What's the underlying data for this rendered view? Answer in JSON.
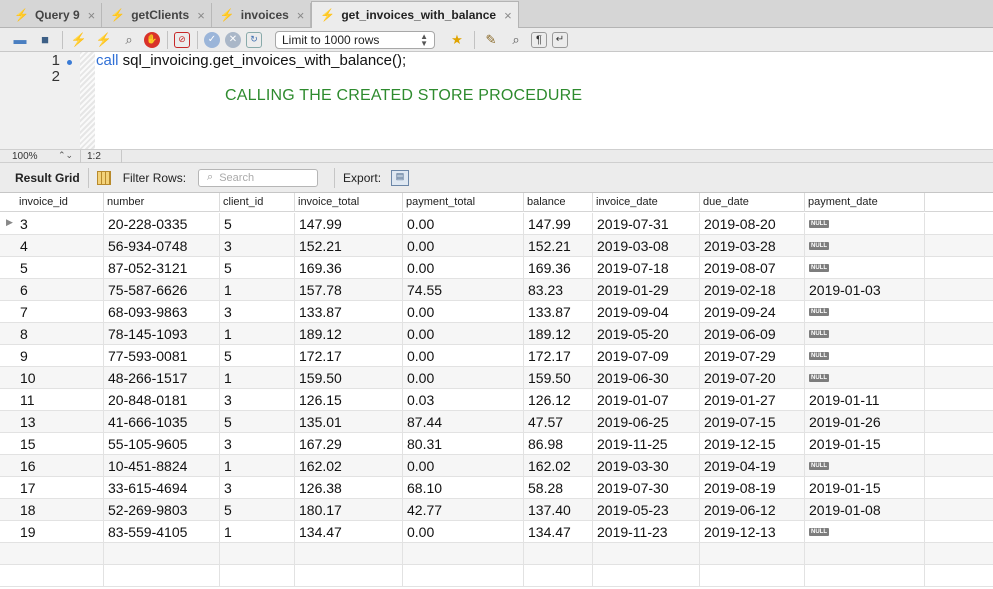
{
  "tabs": [
    {
      "label": "Query 9",
      "active": false
    },
    {
      "label": "getClients",
      "active": false
    },
    {
      "label": "invoices",
      "active": false
    },
    {
      "label": "get_invoices_with_balance",
      "active": true
    }
  ],
  "toolbar": {
    "limit_value": "Limit to 1000 rows",
    "icons": [
      "open-file-icon",
      "save-icon",
      "execute-icon",
      "execute-current-icon",
      "explain-icon",
      "stop-icon",
      "toggle-error-icon",
      "commit-icon",
      "rollback-icon",
      "autocommit-icon",
      "bookmark-icon",
      "beautify-icon",
      "find-icon",
      "invisible-chars-icon",
      "wrap-icon"
    ]
  },
  "editor": {
    "lines": [
      {
        "number": "1",
        "keyword": "call",
        "rest": " sql_invoicing.get_invoices_with_balance();"
      },
      {
        "number": "2",
        "keyword": "",
        "rest": ""
      }
    ],
    "annotation": "CALLING THE CREATED STORE PROCEDURE"
  },
  "editor_status": {
    "zoom": "100%",
    "cursor": "1:2"
  },
  "result_toolbar": {
    "result_grid_label": "Result Grid",
    "filter_label": "Filter Rows:",
    "search_placeholder": "Search",
    "export_label": "Export:"
  },
  "grid": {
    "columns": [
      "invoice_id",
      "number",
      "client_id",
      "invoice_total",
      "payment_total",
      "balance",
      "invoice_date",
      "due_date",
      "payment_date"
    ],
    "null_label": "NULL",
    "rows": [
      [
        "3",
        "20-228-0335",
        "5",
        "147.99",
        "0.00",
        "147.99",
        "2019-07-31",
        "2019-08-20",
        null
      ],
      [
        "4",
        "56-934-0748",
        "3",
        "152.21",
        "0.00",
        "152.21",
        "2019-03-08",
        "2019-03-28",
        null
      ],
      [
        "5",
        "87-052-3121",
        "5",
        "169.36",
        "0.00",
        "169.36",
        "2019-07-18",
        "2019-08-07",
        null
      ],
      [
        "6",
        "75-587-6626",
        "1",
        "157.78",
        "74.55",
        "83.23",
        "2019-01-29",
        "2019-02-18",
        "2019-01-03"
      ],
      [
        "7",
        "68-093-9863",
        "3",
        "133.87",
        "0.00",
        "133.87",
        "2019-09-04",
        "2019-09-24",
        null
      ],
      [
        "8",
        "78-145-1093",
        "1",
        "189.12",
        "0.00",
        "189.12",
        "2019-05-20",
        "2019-06-09",
        null
      ],
      [
        "9",
        "77-593-0081",
        "5",
        "172.17",
        "0.00",
        "172.17",
        "2019-07-09",
        "2019-07-29",
        null
      ],
      [
        "10",
        "48-266-1517",
        "1",
        "159.50",
        "0.00",
        "159.50",
        "2019-06-30",
        "2019-07-20",
        null
      ],
      [
        "11",
        "20-848-0181",
        "3",
        "126.15",
        "0.03",
        "126.12",
        "2019-01-07",
        "2019-01-27",
        "2019-01-11"
      ],
      [
        "13",
        "41-666-1035",
        "5",
        "135.01",
        "87.44",
        "47.57",
        "2019-06-25",
        "2019-07-15",
        "2019-01-26"
      ],
      [
        "15",
        "55-105-9605",
        "3",
        "167.29",
        "80.31",
        "86.98",
        "2019-11-25",
        "2019-12-15",
        "2019-01-15"
      ],
      [
        "16",
        "10-451-8824",
        "1",
        "162.02",
        "0.00",
        "162.02",
        "2019-03-30",
        "2019-04-19",
        null
      ],
      [
        "17",
        "33-615-4694",
        "3",
        "126.38",
        "68.10",
        "58.28",
        "2019-07-30",
        "2019-08-19",
        "2019-01-15"
      ],
      [
        "18",
        "52-269-9803",
        "5",
        "180.17",
        "42.77",
        "137.40",
        "2019-05-23",
        "2019-06-12",
        "2019-01-08"
      ],
      [
        "19",
        "83-559-4105",
        "1",
        "134.47",
        "0.00",
        "134.47",
        "2019-11-23",
        "2019-12-13",
        null
      ]
    ]
  }
}
